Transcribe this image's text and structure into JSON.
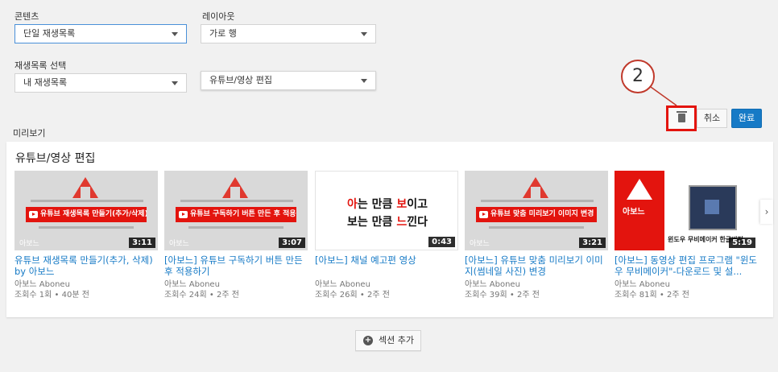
{
  "settings": {
    "content_label": "콘텐츠",
    "content_value": "단일 재생목록",
    "layout_label": "레이아웃",
    "layout_value": "가로 행",
    "playlist_label": "재생목록 선택",
    "playlist_value": "내 재생목록",
    "playlist_name_value": "유튜브/영상 편집"
  },
  "callout_number": "2",
  "actions": {
    "trash_icon": "trash-icon",
    "cancel_label": "취소",
    "done_label": "완료"
  },
  "preview_label": "미리보기",
  "section": {
    "title": "유튜브/영상 편집",
    "next_arrow": "›"
  },
  "videos": [
    {
      "thumb_banner": "유튜브 재생목록 만들기(추가/삭제)",
      "thumb_watermark": "아보느",
      "duration": "3:11",
      "title": "유튜브 재생목록 만들기(추가, 삭제) by 아보느",
      "channel": "아보느 Aboneu",
      "stats": "조회수 1회 • 40분 전"
    },
    {
      "thumb_banner": "유튜브 구독하기 버튼 만든 후 적용",
      "thumb_watermark": "아보느",
      "duration": "3:07",
      "title": "[아보느] 유튜브 구독하기 버튼 만든 후 적용하기",
      "channel": "아보느 Aboneu",
      "stats": "조회수 24회 • 2주 전"
    },
    {
      "thumb_line1_a": "아",
      "thumb_line1_b": "는 만큼 ",
      "thumb_line1_c": "보",
      "thumb_line1_d": "이고",
      "thumb_line2_a": "보는 만큼 ",
      "thumb_line2_b": "느",
      "thumb_line2_c": "낀다",
      "duration": "0:43",
      "title": "[아보느] 채널 예고편 영상",
      "channel": "아보느 Aboneu",
      "stats": "조회수 26회 • 2주 전"
    },
    {
      "thumb_banner": "유튜브 맞춤 미리보기 이미지 변경",
      "thumb_watermark": "아보느",
      "duration": "3:21",
      "title": "[아보느] 유튜브 맞춤 미리보기 이미지(썸네일 사진) 변경",
      "channel": "아보느 Aboneu",
      "stats": "조회수 39회 • 2주 전"
    },
    {
      "thumb_red_text": "아보느",
      "thumb_caption": "윈도우 무비메이커 한글버전",
      "duration": "5:19",
      "title": "[아보느] 동영상 편집 프로그램 \"윈도우 무비메이커\"-다운로드 및 설...",
      "channel": "아보느 Aboneu",
      "stats": "조회수 81회 • 2주 전"
    }
  ],
  "add_section_label": "섹션 추가"
}
